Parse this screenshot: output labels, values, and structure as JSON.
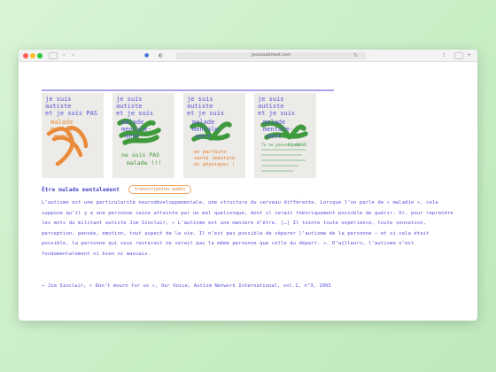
{
  "browser": {
    "url": "jesuisautisteet.com"
  },
  "posters": [
    {
      "lines": [
        "je suis",
        "autiste",
        "et je suis PAS",
        "malade",
        "mentale-",
        "ment"
      ],
      "scribble_color": "#e98b3a"
    },
    {
      "lines": [
        "je suis",
        "autiste",
        "et je suis",
        "malade",
        "mentale-",
        "ment"
      ],
      "caption": [
        "ne suis PAS",
        "malade !!!"
      ],
      "scribble_color": "#3f9a3c"
    },
    {
      "lines": [
        "je suis",
        "autiste",
        "et je suis",
        "malade",
        "mentale-",
        "ment"
      ],
      "caption": [
        "en parfaite",
        "santé (mentale",
        "et physique) !"
      ],
      "scribble_color": "#3f9a3c"
    },
    {
      "lines": [
        "je suis",
        "autiste",
        "et je suis",
        "malade",
        "mentale-",
        "ment"
      ],
      "caption": [
        "Tu ne penses pas",
        "SO GRAVE"
      ],
      "scribble_color": "#3f9a3c"
    }
  ],
  "article": {
    "title": "Être malade mentalement",
    "audio_label": "transcription audio",
    "paragraph": "L’autisme est une particularité neurodéveloppementale, une structure du cerveau différente. Lorsque l’on parle de « maladie », cela suppose qu’il y a une personne saine atteinte par un mal quelconque, dont il serait théoriquement possible de guérir. Or, pour reprendre les mots du militant autiste Jim Sinclair, « L’autisme est une manière d’être. […] Il teinte toute expérience, toute sensation, perception, pensée, émotion, tout aspect de la vie. Il n’est pas possible de séparer l’autisme de la personne – et si cela était possible, la personne qui vous resterait ne serait pas la même personne que celle du départ. ». D’ailleurs, l’autisme n’est fondamentalement ni bien ni mauvais.",
    "reference": "→ Jim Sinclair, « Don’t mourn for us », Our Voice, Autism Network International, vol.1, n°3, 1993"
  },
  "colors": {
    "text_blue": "#5a55d6",
    "accent_orange": "#e57c2a",
    "scribble_green": "#3f9a3c",
    "scribble_orange": "#e98b3a"
  }
}
